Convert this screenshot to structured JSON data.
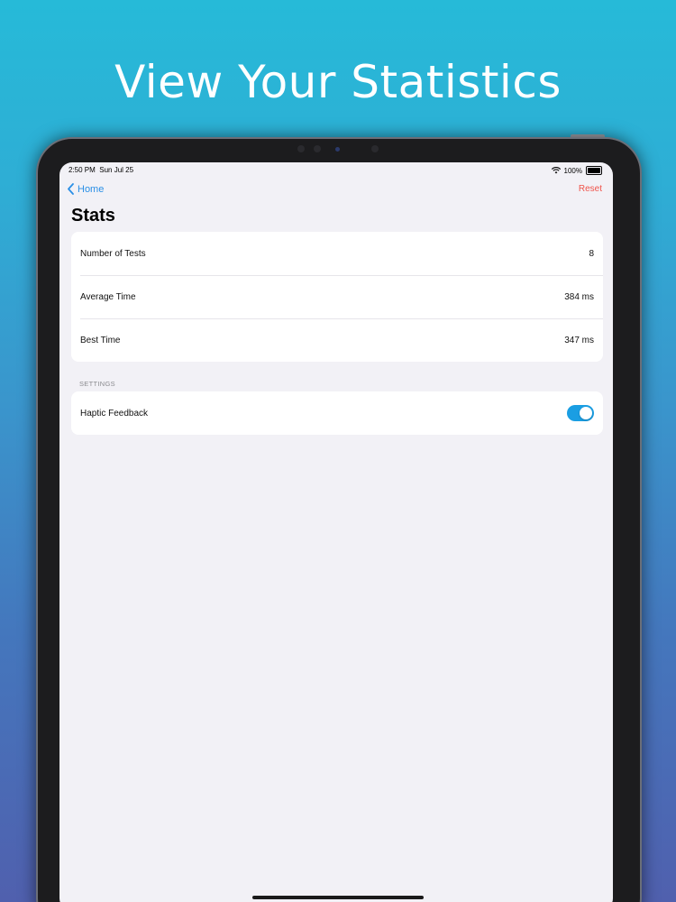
{
  "headline": "View Your Statistics",
  "status_bar": {
    "time": "2:50 PM",
    "date": "Sun Jul 25",
    "battery": "100%",
    "battery_level": 1.0
  },
  "nav": {
    "back_label": "Home",
    "reset_label": "Reset"
  },
  "title": "Stats",
  "stats": [
    {
      "label": "Number of Tests",
      "value": "8"
    },
    {
      "label": "Average Time",
      "value": "384 ms"
    },
    {
      "label": "Best Time",
      "value": "347 ms"
    }
  ],
  "settings": {
    "header": "SETTINGS",
    "items": [
      {
        "label": "Haptic Feedback",
        "enabled": true
      }
    ]
  },
  "colors": {
    "accent": "#2a8fe6",
    "destructive": "#f0534a",
    "toggle_on": "#1a9ee3"
  }
}
